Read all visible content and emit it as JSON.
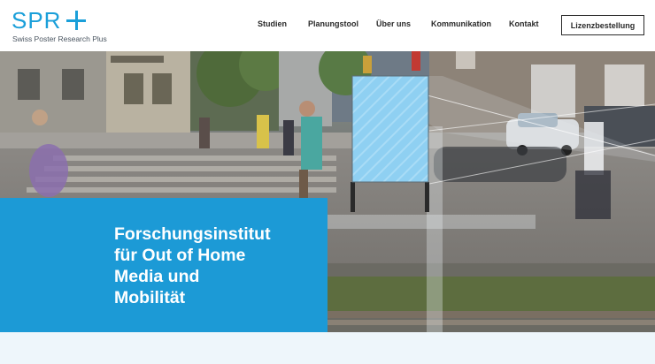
{
  "logo": {
    "letters": "SPR",
    "subtitle": "Swiss Poster Research Plus"
  },
  "nav": {
    "items": [
      {
        "label": "Studien"
      },
      {
        "label": "Planungstool"
      },
      {
        "label": "Über uns"
      },
      {
        "label": "Kommunikation"
      },
      {
        "label": "Kontakt"
      }
    ],
    "cta_label": "Lizenzbestellung"
  },
  "hero": {
    "title_lines": [
      "Forschungsinstitut",
      "für Out of Home",
      "Media und",
      "Mobilität"
    ]
  },
  "colors": {
    "brand_blue": "#1c9ad6",
    "poster_blue": "#8fd0f2",
    "text_dark": "#2a2a2a"
  }
}
